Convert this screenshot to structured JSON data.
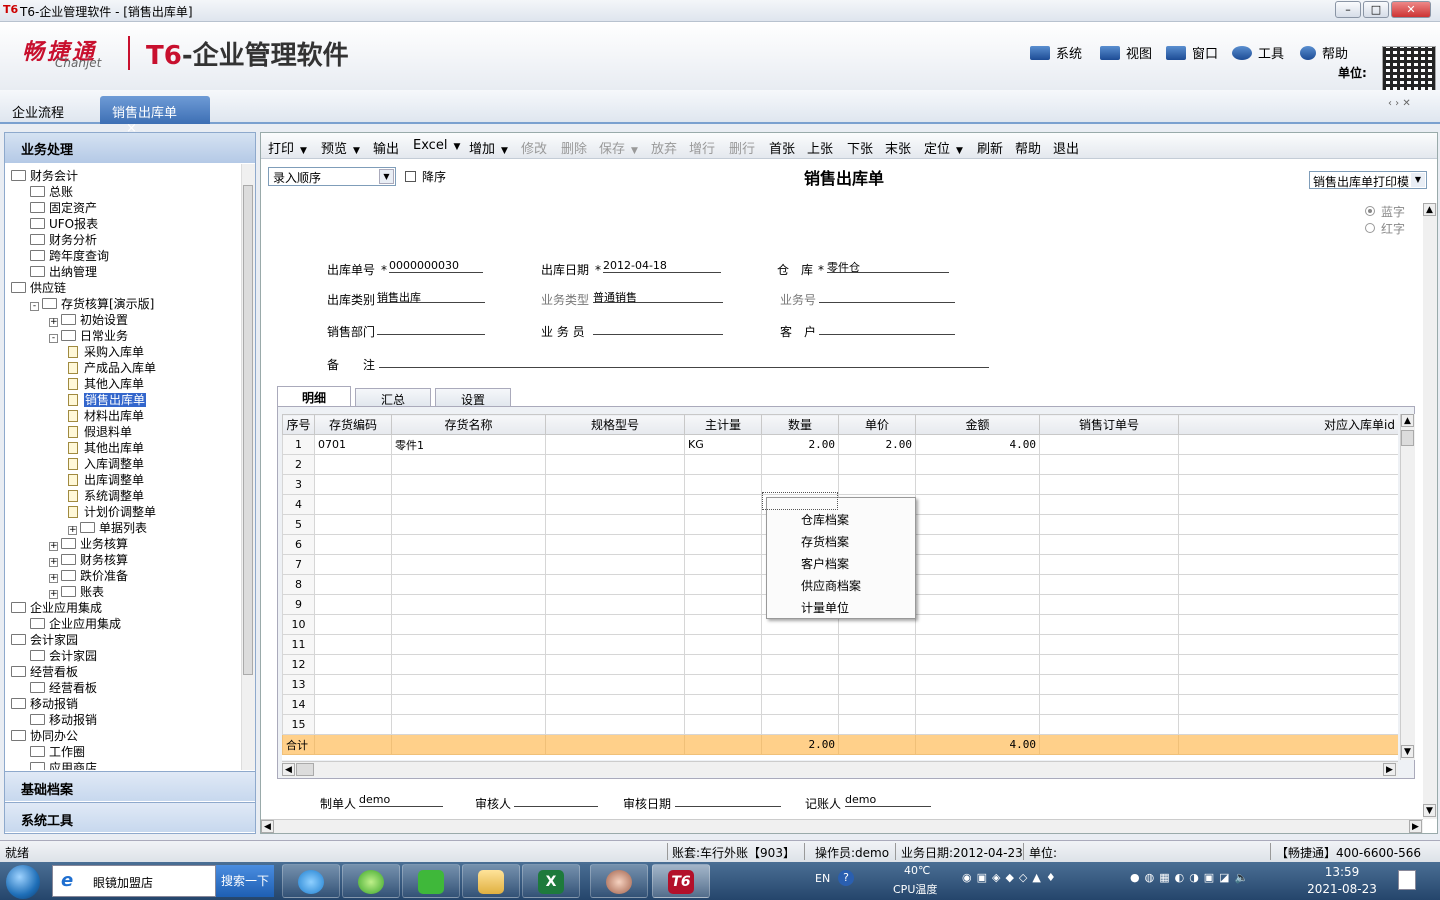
{
  "window": {
    "app_icon": "T6",
    "title": "T6-企业管理软件 - [销售出库单]"
  },
  "header": {
    "brand_cn": "畅捷通",
    "brand_en": "Chanjet",
    "product_prefix": "T6",
    "product_name": "-企业管理软件",
    "menu": [
      {
        "label": "系统",
        "icon": "monitor-icon"
      },
      {
        "label": "视图",
        "icon": "grid-icon"
      },
      {
        "label": "窗口",
        "icon": "window-icon"
      },
      {
        "label": "工具",
        "icon": "gear-icon"
      },
      {
        "label": "帮助",
        "icon": "help-icon"
      }
    ],
    "unit_label": "单位:"
  },
  "tabs": [
    {
      "label": "企业流程"
    },
    {
      "label": "销售出库单",
      "close": "×"
    }
  ],
  "sidebar": {
    "title": "业务处理",
    "tree": [
      {
        "label": "财务会计",
        "level": 0,
        "kind": "folder"
      },
      {
        "label": "总账",
        "level": 1,
        "kind": "folder"
      },
      {
        "label": "固定资产",
        "level": 1,
        "kind": "folder"
      },
      {
        "label": "UFO报表",
        "level": 1,
        "kind": "folder"
      },
      {
        "label": "财务分析",
        "level": 1,
        "kind": "folder"
      },
      {
        "label": "跨年度查询",
        "level": 1,
        "kind": "folder"
      },
      {
        "label": "出纳管理",
        "level": 1,
        "kind": "folder"
      },
      {
        "label": "供应链",
        "level": 0,
        "kind": "folder"
      },
      {
        "label": "存货核算[演示版]",
        "level": 1,
        "kind": "folder",
        "pm": "-"
      },
      {
        "label": "初始设置",
        "level": 2,
        "kind": "folder",
        "pm": "+"
      },
      {
        "label": "日常业务",
        "level": 2,
        "kind": "folder",
        "pm": "-"
      },
      {
        "label": "采购入库单",
        "level": 3,
        "kind": "doc"
      },
      {
        "label": "产成品入库单",
        "level": 3,
        "kind": "doc"
      },
      {
        "label": "其他入库单",
        "level": 3,
        "kind": "doc"
      },
      {
        "label": "销售出库单",
        "level": 3,
        "kind": "doc",
        "selected": true
      },
      {
        "label": "材料出库单",
        "level": 3,
        "kind": "doc"
      },
      {
        "label": "假退料单",
        "level": 3,
        "kind": "doc"
      },
      {
        "label": "其他出库单",
        "level": 3,
        "kind": "doc"
      },
      {
        "label": "入库调整单",
        "level": 3,
        "kind": "doc"
      },
      {
        "label": "出库调整单",
        "level": 3,
        "kind": "doc"
      },
      {
        "label": "系统调整单",
        "level": 3,
        "kind": "doc"
      },
      {
        "label": "计划价调整单",
        "level": 3,
        "kind": "doc"
      },
      {
        "label": "单据列表",
        "level": 3,
        "kind": "folder",
        "pm": "+"
      },
      {
        "label": "业务核算",
        "level": 2,
        "kind": "folder",
        "pm": "+"
      },
      {
        "label": "财务核算",
        "level": 2,
        "kind": "folder",
        "pm": "+"
      },
      {
        "label": "跌价准备",
        "level": 2,
        "kind": "folder",
        "pm": "+"
      },
      {
        "label": "账表",
        "level": 2,
        "kind": "folder",
        "pm": "+"
      },
      {
        "label": "企业应用集成",
        "level": 0,
        "kind": "folder"
      },
      {
        "label": "企业应用集成",
        "level": 1,
        "kind": "folder"
      },
      {
        "label": "会计家园",
        "level": 0,
        "kind": "folder"
      },
      {
        "label": "会计家园",
        "level": 1,
        "kind": "folder"
      },
      {
        "label": "经营看板",
        "level": 0,
        "kind": "folder"
      },
      {
        "label": "经营看板",
        "level": 1,
        "kind": "folder"
      },
      {
        "label": "移动报销",
        "level": 0,
        "kind": "folder"
      },
      {
        "label": "移动报销",
        "level": 1,
        "kind": "folder"
      },
      {
        "label": "协同办公",
        "level": 0,
        "kind": "folder"
      },
      {
        "label": "工作圈",
        "level": 1,
        "kind": "folder"
      },
      {
        "label": "应用商店",
        "level": 1,
        "kind": "folder"
      }
    ],
    "sections": [
      "基础档案",
      "系统工具"
    ]
  },
  "toolbar": [
    {
      "label": "打印",
      "dropdown": true,
      "enabled": true
    },
    {
      "label": "预览",
      "dropdown": true,
      "enabled": true
    },
    {
      "label": "输出",
      "enabled": true
    },
    {
      "label": "Excel",
      "dropdown": true,
      "enabled": true
    },
    {
      "label": "增加",
      "dropdown": true,
      "enabled": true
    },
    {
      "label": "修改",
      "enabled": false
    },
    {
      "label": "删除",
      "enabled": false
    },
    {
      "label": "保存",
      "dropdown": true,
      "enabled": false
    },
    {
      "label": "放弃",
      "enabled": false
    },
    {
      "label": "增行",
      "enabled": false
    },
    {
      "label": "删行",
      "enabled": false
    },
    {
      "label": "首张",
      "enabled": true
    },
    {
      "label": "上张",
      "enabled": true
    },
    {
      "label": "下张",
      "enabled": true
    },
    {
      "label": "末张",
      "enabled": true
    },
    {
      "label": "定位",
      "dropdown": true,
      "enabled": true
    },
    {
      "label": "刷新",
      "enabled": true
    },
    {
      "label": "帮助",
      "enabled": true
    },
    {
      "label": "退出",
      "enabled": true
    }
  ],
  "form": {
    "order_select": "录入顺序",
    "desc_label": "降序",
    "title": "销售出库单",
    "print_template": "销售出库单打印模",
    "color_options": [
      "蓝字",
      "红字"
    ],
    "fields": {
      "out_no": {
        "label": "出库单号",
        "value": "0000000030",
        "required": true
      },
      "out_date": {
        "label": "出库日期",
        "value": "2012-04-18",
        "required": true
      },
      "warehouse": {
        "label": "仓　库",
        "value": "零件仓",
        "required": true
      },
      "out_type": {
        "label": "出库类别",
        "value": "销售出库"
      },
      "biz_type": {
        "label": "业务类型",
        "value": "普通销售"
      },
      "biz_no": {
        "label": "业务号",
        "value": ""
      },
      "sales_dept": {
        "label": "销售部门",
        "value": ""
      },
      "salesman": {
        "label": "业 务 员",
        "value": ""
      },
      "customer": {
        "label": "客　户",
        "value": ""
      },
      "remark": {
        "label": "备　　注",
        "value": ""
      }
    }
  },
  "grid": {
    "tabs": [
      "明细",
      "汇总",
      "设置"
    ],
    "columns": [
      "序号",
      "存货编码",
      "存货名称",
      "规格型号",
      "主计量",
      "数量",
      "单价",
      "金额",
      "销售订单号",
      "对应入库单id"
    ],
    "rows": [
      [
        "1",
        "0701",
        "零件1",
        "",
        "KG",
        "2.00",
        "2.00",
        "4.00",
        "",
        ""
      ],
      [
        "2",
        "",
        "",
        "",
        "",
        "",
        "",
        "",
        "",
        ""
      ],
      [
        "3",
        "",
        "",
        "",
        "",
        "",
        "",
        "",
        "",
        ""
      ],
      [
        "4",
        "",
        "",
        "",
        "",
        "",
        "",
        "",
        "",
        ""
      ],
      [
        "5",
        "",
        "",
        "",
        "",
        "",
        "",
        "",
        "",
        ""
      ],
      [
        "6",
        "",
        "",
        "",
        "",
        "",
        "",
        "",
        "",
        ""
      ],
      [
        "7",
        "",
        "",
        "",
        "",
        "",
        "",
        "",
        "",
        ""
      ],
      [
        "8",
        "",
        "",
        "",
        "",
        "",
        "",
        "",
        "",
        ""
      ],
      [
        "9",
        "",
        "",
        "",
        "",
        "",
        "",
        "",
        "",
        ""
      ],
      [
        "10",
        "",
        "",
        "",
        "",
        "",
        "",
        "",
        "",
        ""
      ],
      [
        "11",
        "",
        "",
        "",
        "",
        "",
        "",
        "",
        "",
        ""
      ],
      [
        "12",
        "",
        "",
        "",
        "",
        "",
        "",
        "",
        "",
        ""
      ],
      [
        "13",
        "",
        "",
        "",
        "",
        "",
        "",
        "",
        "",
        ""
      ],
      [
        "14",
        "",
        "",
        "",
        "",
        "",
        "",
        "",
        "",
        ""
      ],
      [
        "15",
        "",
        "",
        "",
        "",
        "",
        "",
        "",
        "",
        ""
      ]
    ],
    "total": [
      "合计",
      "",
      "",
      "",
      "",
      "2.00",
      "",
      "4.00",
      "",
      ""
    ]
  },
  "context_menu": [
    "仓库档案",
    "存货档案",
    "客户档案",
    "供应商档案",
    "计量单位"
  ],
  "footer_fields": {
    "maker": {
      "label": "制单人",
      "value": "demo"
    },
    "auditor": {
      "label": "审核人",
      "value": ""
    },
    "audit_date": {
      "label": "审核日期",
      "value": ""
    },
    "bookkeeper": {
      "label": "记账人",
      "value": "demo"
    }
  },
  "statusbar": {
    "ready": "就绪",
    "account": "账套:车行外账【903】",
    "operator": "操作员:demo",
    "biz_date": "业务日期:2012-04-23",
    "unit": "单位:",
    "hotline": "【畅捷通】400-6600-566"
  },
  "taskbar": {
    "search_text": "眼镜加盟店",
    "search_button": "搜索一下",
    "apps": [
      {
        "icon": "browser-icon"
      },
      {
        "icon": "360-icon"
      },
      {
        "icon": "wechat-icon"
      },
      {
        "icon": "folder-icon"
      },
      {
        "icon": "excel-icon"
      },
      {
        "icon": "photo-icon"
      },
      {
        "icon": "t6-icon",
        "label": "T6"
      }
    ],
    "ime": "EN",
    "temp": "40℃",
    "temp_label": "CPU温度",
    "time": "13:59",
    "date": "2021-08-23"
  },
  "colors": {
    "accent": "#3d6fb4",
    "brand": "#c8102e",
    "total_row": "#ffd08a"
  }
}
